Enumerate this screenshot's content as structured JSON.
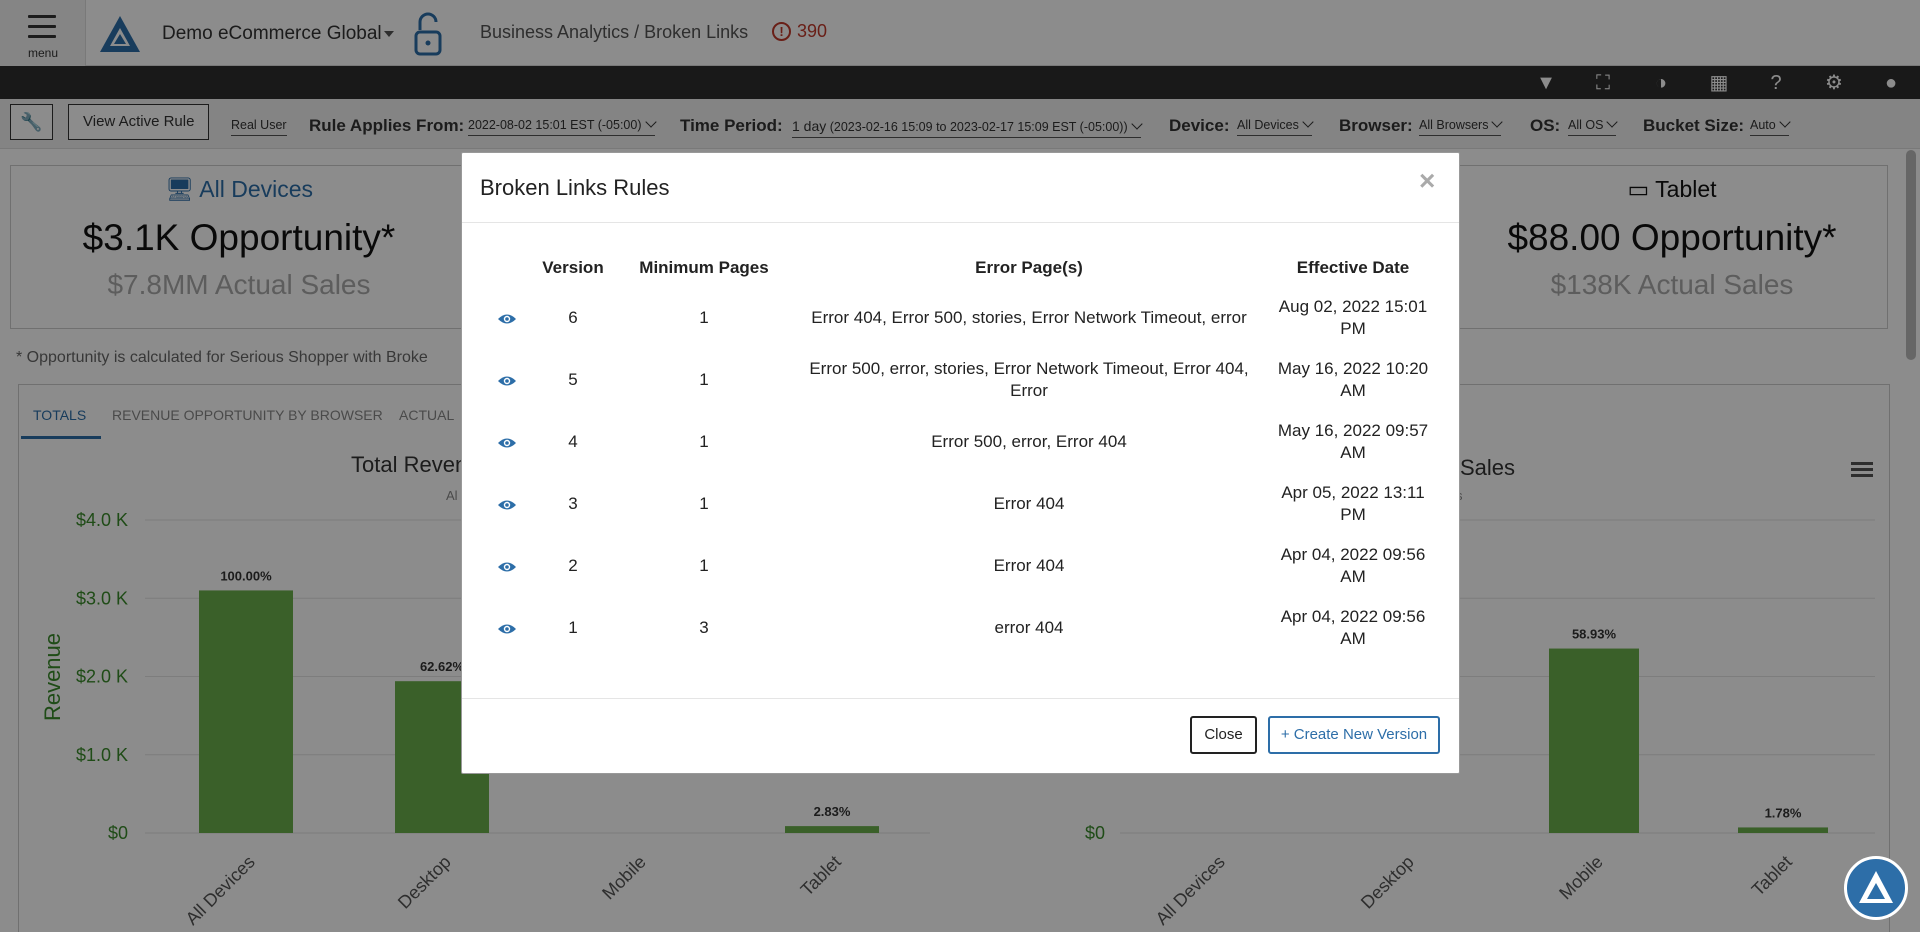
{
  "header": {
    "menu_label": "menu",
    "org_name": "Demo eCommerce Global",
    "breadcrumb": "Business Analytics / Broken Links",
    "alert_count": "390"
  },
  "filters": {
    "view_active_rule": "View Active Rule",
    "real_user": "Real User",
    "rule_applies_label": "Rule Applies From:",
    "rule_applies_value": "2022-08-02 15:01 EST (-05:00)",
    "time_period_label": "Time Period:",
    "time_period_value": "1 day",
    "time_period_range": "(2023-02-16 15:09 to 2023-02-17 15:09 EST (-05:00))",
    "device_label": "Device:",
    "device_value": "All Devices",
    "browser_label": "Browser:",
    "browser_value": "All Browsers",
    "os_label": "OS:",
    "os_value": "All OS",
    "bucket_label": "Bucket Size:",
    "bucket_value": "Auto"
  },
  "cards": {
    "all": {
      "title": "All Devices",
      "opportunity": "$3.1K Opportunity*",
      "sales": "$7.8MM Actual Sales"
    },
    "tablet": {
      "title": "Tablet",
      "opportunity": "$88.00 Opportunity*",
      "sales": "$138K Actual Sales"
    }
  },
  "footnote": "* Opportunity is calculated for Serious Shopper with Broke",
  "tabs": [
    "TOTALS",
    "REVENUE OPPORTUNITY BY BROWSER",
    "ACTUAL"
  ],
  "charts": {
    "left_title": "Total Reven",
    "left_sub": "Al",
    "right_title": "Sales",
    "right_sub": "s"
  },
  "chart_data": [
    {
      "type": "bar",
      "title": "Total Reven",
      "ylabel": "Revenue",
      "categories": [
        "All Devices",
        "Desktop",
        "Mobile",
        "Tablet"
      ],
      "values": [
        3.1,
        1.94,
        null,
        0.088
      ],
      "labels": [
        "100.00%",
        "62.62%",
        "",
        "2.83%"
      ],
      "yticks": [
        "$0",
        "$1.0 K",
        "$2.0 K",
        "$3.0 K",
        "$4.0 K"
      ],
      "ylim": [
        0,
        4
      ],
      "color": "#6ab04c"
    },
    {
      "type": "bar",
      "title": "Sales",
      "categories": [
        "All Devices",
        "Desktop",
        "Mobile",
        "Tablet"
      ],
      "values": [
        null,
        null,
        58.93,
        1.78
      ],
      "labels": [
        "",
        "",
        "58.93%",
        "1.78%"
      ],
      "yticks": [
        "$0"
      ],
      "ylim": [
        0,
        100
      ],
      "color": "#6ab04c"
    }
  ],
  "modal": {
    "title": "Broken Links Rules",
    "close_x": "×",
    "columns": [
      "",
      "Version",
      "Minimum Pages",
      "Error Page(s)",
      "Effective Date"
    ],
    "rows": [
      {
        "version": "6",
        "min_pages": "1",
        "error_pages": "Error 404, Error 500, stories, Error Network Timeout, error",
        "date": "Aug 02, 2022 15:01 PM"
      },
      {
        "version": "5",
        "min_pages": "1",
        "error_pages": "Error 500, error, stories, Error Network Timeout, Error 404, Error",
        "date": "May 16, 2022 10:20 AM"
      },
      {
        "version": "4",
        "min_pages": "1",
        "error_pages": "Error 500, error, Error 404",
        "date": "May 16, 2022 09:57 AM"
      },
      {
        "version": "3",
        "min_pages": "1",
        "error_pages": "Error 404",
        "date": "Apr 05, 2022 13:11 PM"
      },
      {
        "version": "2",
        "min_pages": "1",
        "error_pages": "Error 404",
        "date": "Apr 04, 2022 09:56 AM"
      },
      {
        "version": "1",
        "min_pages": "3",
        "error_pages": "error 404",
        "date": "Apr 04, 2022 09:56 AM"
      }
    ],
    "close_button": "Close",
    "create_button": "+ Create New Version"
  },
  "colors": {
    "accent": "#2d6ea8",
    "bar": "#6ab04c",
    "alert": "#c0392b"
  }
}
